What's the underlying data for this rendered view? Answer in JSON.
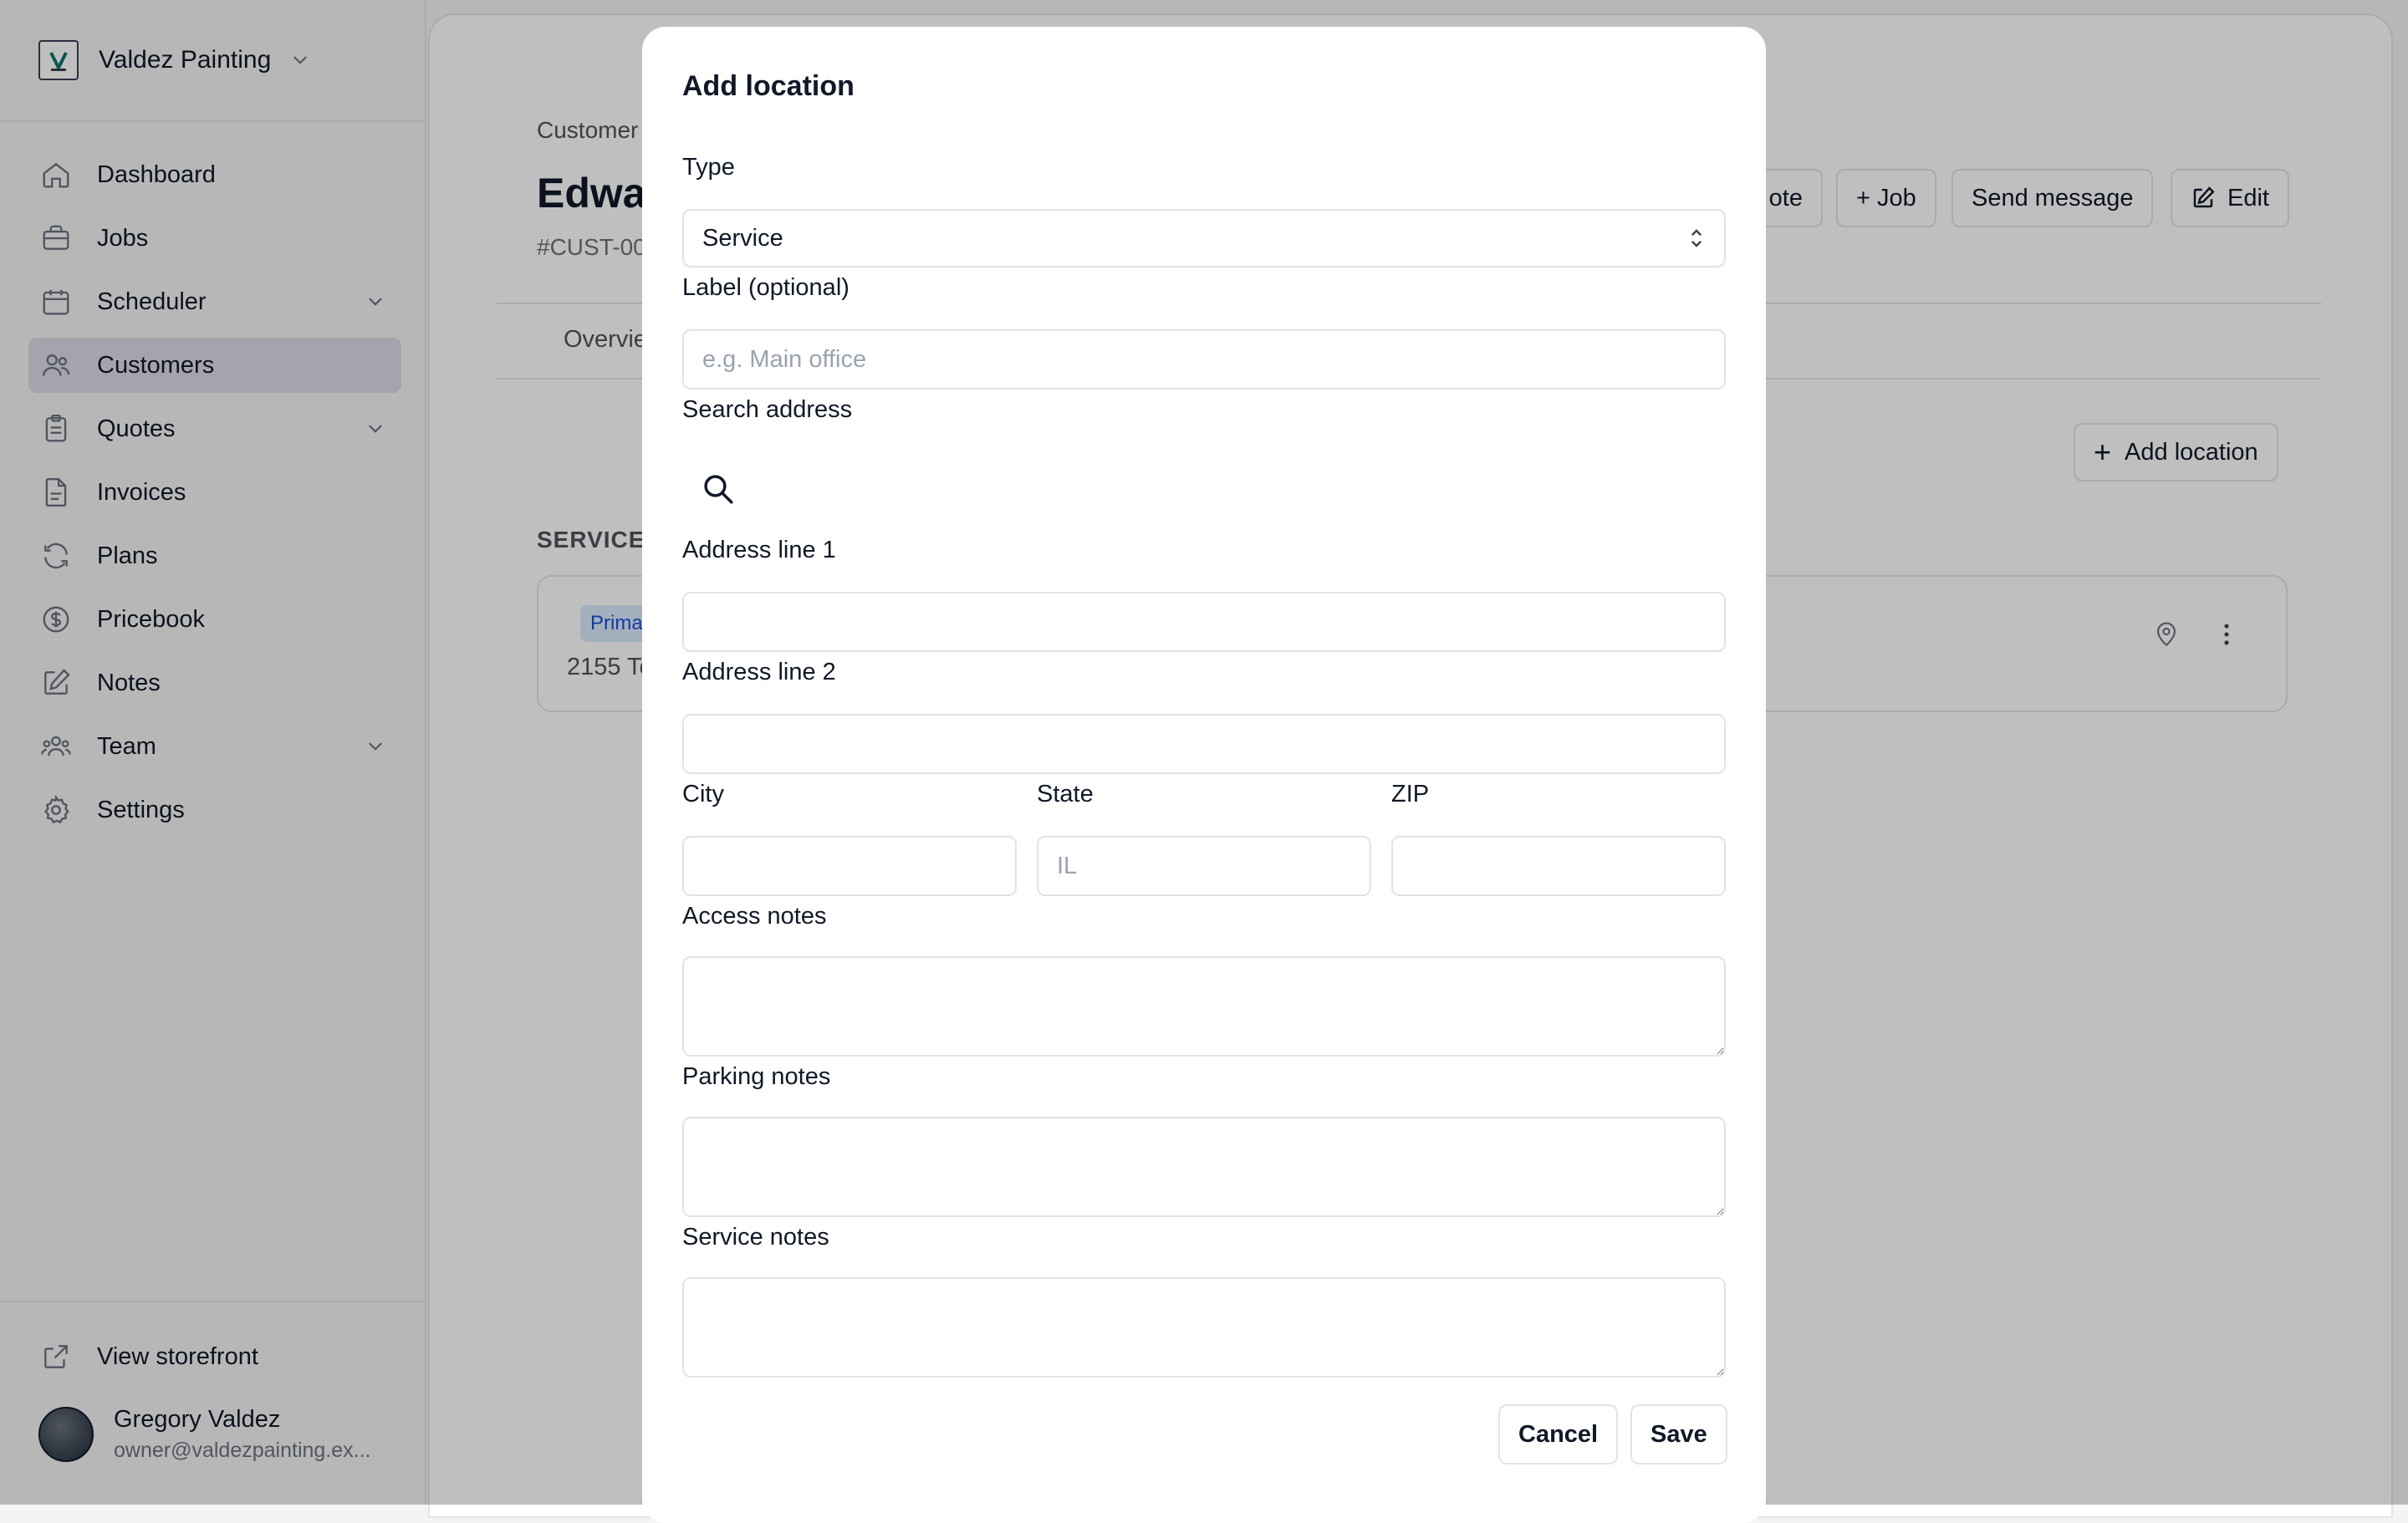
{
  "sidebar": {
    "brand_name": "Valdez Painting",
    "nav": [
      {
        "label": "Dashboard",
        "icon": "home-icon"
      },
      {
        "label": "Jobs",
        "icon": "briefcase-icon"
      },
      {
        "label": "Scheduler",
        "icon": "calendar-icon",
        "has_children": true
      },
      {
        "label": "Customers",
        "icon": "users-icon",
        "active": true
      },
      {
        "label": "Quotes",
        "icon": "clipboard-icon",
        "has_children": true
      },
      {
        "label": "Invoices",
        "icon": "document-icon"
      },
      {
        "label": "Plans",
        "icon": "refresh-icon"
      },
      {
        "label": "Pricebook",
        "icon": "dollar-icon"
      },
      {
        "label": "Notes",
        "icon": "pencil-square-icon"
      },
      {
        "label": "Team",
        "icon": "user-group-icon",
        "has_children": true
      },
      {
        "label": "Settings",
        "icon": "gear-icon"
      }
    ],
    "storefront_label": "View storefront",
    "user": {
      "name": "Gregory Valdez",
      "email": "owner@valdezpainting.ex..."
    }
  },
  "page": {
    "breadcrumb": "Customer",
    "customer_title": "Edwa",
    "customer_id": "#CUST-00",
    "actions": {
      "quote": "ote",
      "job": "+ Job",
      "message": "Send message",
      "edit": "Edit"
    },
    "tab_overview": "Overvie",
    "add_location": "Add location",
    "section_label": "SERVICE",
    "location": {
      "badge": "Prima",
      "address": "2155 To"
    }
  },
  "modal": {
    "title": "Add location",
    "type_label": "Type",
    "type_value": "Service",
    "label_label": "Label (optional)",
    "label_placeholder": "e.g. Main office",
    "search_label": "Search address",
    "address1_label": "Address line 1",
    "address2_label": "Address line 2",
    "city_label": "City",
    "state_label": "State",
    "state_placeholder": "IL",
    "zip_label": "ZIP",
    "access_label": "Access notes",
    "parking_label": "Parking notes",
    "service_label": "Service notes",
    "cancel": "Cancel",
    "save": "Save"
  },
  "colors": {
    "active_nav": "#dcdbe6",
    "badge_bg": "#dbeafe",
    "badge_text": "#1d4ed8",
    "overlay": "rgba(0,0,0,0.25)"
  }
}
